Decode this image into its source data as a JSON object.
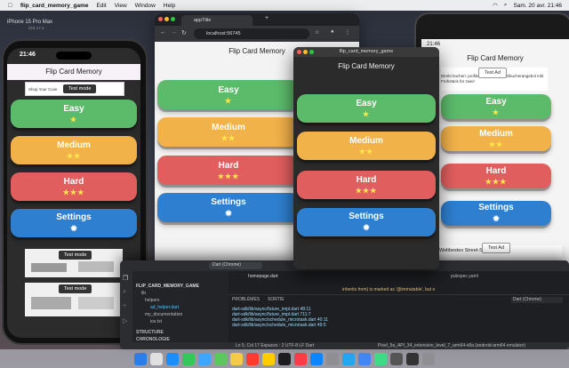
{
  "menubar": {
    "app_name": "flip_card_memory_game",
    "items": [
      "Edit",
      "View",
      "Window",
      "Help"
    ],
    "clock": "Sam. 20 avr. 21:46"
  },
  "phone1": {
    "device_label": "iPhone 15 Pro Max",
    "device_sub": "iOS 17.4",
    "time": "21:46",
    "title": "Flip Card Memory",
    "banner_text": "Shop Your Cove",
    "test_mode": "Test mode",
    "buttons": {
      "easy": "Easy",
      "medium": "Medium",
      "hard": "Hard",
      "settings": "Settings"
    },
    "stars": {
      "easy": "★",
      "medium": "★★",
      "hard": "★★★"
    }
  },
  "chrome": {
    "tab_title": "appTitle",
    "url": "localhost:56745",
    "title": "Flip Card Memory"
  },
  "macwin": {
    "window_title": "flip_card_memory_game",
    "title": "Flip Card Memory"
  },
  "android": {
    "time": "21:46",
    "title": "Flip Card Memory",
    "ad_label": "Test Ad",
    "ad_text": "Direkt buchen: profitieren Sie von Frühbucherangebot inkl. Frühstück für zwei!",
    "bottom_ad": "Weltbestes Street-Sport",
    "bottom_ad_label": "Test Ad"
  },
  "ide": {
    "project": "FLIP_CARD_MEMORY_GAME",
    "files": [
      "lib",
      "helpers",
      "ad_helper.dart",
      "my_documentation",
      "ios.txt"
    ],
    "tab1": "homepage.dart",
    "tab2": "pubspec.yaml",
    "panel_tabs": [
      "PROBLÈMES",
      "SORTIE"
    ],
    "device": "Dart (Chrome)",
    "log_lines": [
      "dart-sdk/lib/async/future_impl.dart 48:11",
      "dart-sdk/lib/async/future_impl.dart 711:7",
      "dart-sdk/lib/async/schedule_microtask.dart 40:11",
      "dart-sdk/lib/async/schedule_microtask.dart 49:5"
    ],
    "warning": "inherits from) is marked as '@immutable', but o",
    "outline": "STRUCTURE",
    "outline2": "CHRONOLOGIE",
    "status": "Ln 5, Col 17   Espaces : 2   UTF-8   LF   Dart",
    "status_right": "Pixel_5a_API_34_extension_level_7_arm64-v8a (android-arm64 emulator)"
  },
  "colors": {
    "easy": "#5cbb6b",
    "medium": "#f2b24a",
    "hard": "#e15e5e",
    "settings": "#2e7fd0"
  }
}
